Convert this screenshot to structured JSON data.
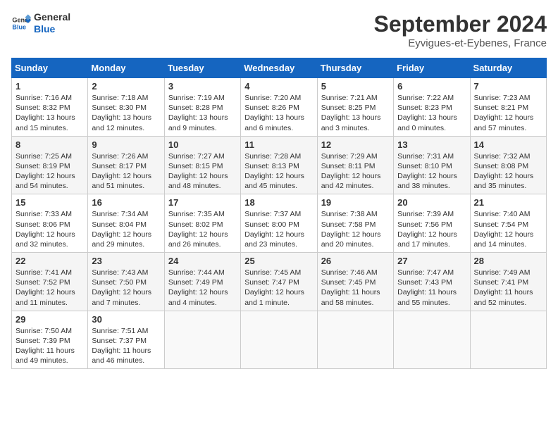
{
  "header": {
    "logo_line1": "General",
    "logo_line2": "Blue",
    "month": "September 2024",
    "location": "Eyvigues-et-Eybenes, France"
  },
  "weekdays": [
    "Sunday",
    "Monday",
    "Tuesday",
    "Wednesday",
    "Thursday",
    "Friday",
    "Saturday"
  ],
  "weeks": [
    [
      {
        "day": "1",
        "content": "Sunrise: 7:16 AM\nSunset: 8:32 PM\nDaylight: 13 hours\nand 15 minutes."
      },
      {
        "day": "2",
        "content": "Sunrise: 7:18 AM\nSunset: 8:30 PM\nDaylight: 13 hours\nand 12 minutes."
      },
      {
        "day": "3",
        "content": "Sunrise: 7:19 AM\nSunset: 8:28 PM\nDaylight: 13 hours\nand 9 minutes."
      },
      {
        "day": "4",
        "content": "Sunrise: 7:20 AM\nSunset: 8:26 PM\nDaylight: 13 hours\nand 6 minutes."
      },
      {
        "day": "5",
        "content": "Sunrise: 7:21 AM\nSunset: 8:25 PM\nDaylight: 13 hours\nand 3 minutes."
      },
      {
        "day": "6",
        "content": "Sunrise: 7:22 AM\nSunset: 8:23 PM\nDaylight: 13 hours\nand 0 minutes."
      },
      {
        "day": "7",
        "content": "Sunrise: 7:23 AM\nSunset: 8:21 PM\nDaylight: 12 hours\nand 57 minutes."
      }
    ],
    [
      {
        "day": "8",
        "content": "Sunrise: 7:25 AM\nSunset: 8:19 PM\nDaylight: 12 hours\nand 54 minutes."
      },
      {
        "day": "9",
        "content": "Sunrise: 7:26 AM\nSunset: 8:17 PM\nDaylight: 12 hours\nand 51 minutes."
      },
      {
        "day": "10",
        "content": "Sunrise: 7:27 AM\nSunset: 8:15 PM\nDaylight: 12 hours\nand 48 minutes."
      },
      {
        "day": "11",
        "content": "Sunrise: 7:28 AM\nSunset: 8:13 PM\nDaylight: 12 hours\nand 45 minutes."
      },
      {
        "day": "12",
        "content": "Sunrise: 7:29 AM\nSunset: 8:11 PM\nDaylight: 12 hours\nand 42 minutes."
      },
      {
        "day": "13",
        "content": "Sunrise: 7:31 AM\nSunset: 8:10 PM\nDaylight: 12 hours\nand 38 minutes."
      },
      {
        "day": "14",
        "content": "Sunrise: 7:32 AM\nSunset: 8:08 PM\nDaylight: 12 hours\nand 35 minutes."
      }
    ],
    [
      {
        "day": "15",
        "content": "Sunrise: 7:33 AM\nSunset: 8:06 PM\nDaylight: 12 hours\nand 32 minutes."
      },
      {
        "day": "16",
        "content": "Sunrise: 7:34 AM\nSunset: 8:04 PM\nDaylight: 12 hours\nand 29 minutes."
      },
      {
        "day": "17",
        "content": "Sunrise: 7:35 AM\nSunset: 8:02 PM\nDaylight: 12 hours\nand 26 minutes."
      },
      {
        "day": "18",
        "content": "Sunrise: 7:37 AM\nSunset: 8:00 PM\nDaylight: 12 hours\nand 23 minutes."
      },
      {
        "day": "19",
        "content": "Sunrise: 7:38 AM\nSunset: 7:58 PM\nDaylight: 12 hours\nand 20 minutes."
      },
      {
        "day": "20",
        "content": "Sunrise: 7:39 AM\nSunset: 7:56 PM\nDaylight: 12 hours\nand 17 minutes."
      },
      {
        "day": "21",
        "content": "Sunrise: 7:40 AM\nSunset: 7:54 PM\nDaylight: 12 hours\nand 14 minutes."
      }
    ],
    [
      {
        "day": "22",
        "content": "Sunrise: 7:41 AM\nSunset: 7:52 PM\nDaylight: 12 hours\nand 11 minutes."
      },
      {
        "day": "23",
        "content": "Sunrise: 7:43 AM\nSunset: 7:50 PM\nDaylight: 12 hours\nand 7 minutes."
      },
      {
        "day": "24",
        "content": "Sunrise: 7:44 AM\nSunset: 7:49 PM\nDaylight: 12 hours\nand 4 minutes."
      },
      {
        "day": "25",
        "content": "Sunrise: 7:45 AM\nSunset: 7:47 PM\nDaylight: 12 hours\nand 1 minute."
      },
      {
        "day": "26",
        "content": "Sunrise: 7:46 AM\nSunset: 7:45 PM\nDaylight: 11 hours\nand 58 minutes."
      },
      {
        "day": "27",
        "content": "Sunrise: 7:47 AM\nSunset: 7:43 PM\nDaylight: 11 hours\nand 55 minutes."
      },
      {
        "day": "28",
        "content": "Sunrise: 7:49 AM\nSunset: 7:41 PM\nDaylight: 11 hours\nand 52 minutes."
      }
    ],
    [
      {
        "day": "29",
        "content": "Sunrise: 7:50 AM\nSunset: 7:39 PM\nDaylight: 11 hours\nand 49 minutes."
      },
      {
        "day": "30",
        "content": "Sunrise: 7:51 AM\nSunset: 7:37 PM\nDaylight: 11 hours\nand 46 minutes."
      },
      {
        "day": "",
        "content": ""
      },
      {
        "day": "",
        "content": ""
      },
      {
        "day": "",
        "content": ""
      },
      {
        "day": "",
        "content": ""
      },
      {
        "day": "",
        "content": ""
      }
    ]
  ]
}
